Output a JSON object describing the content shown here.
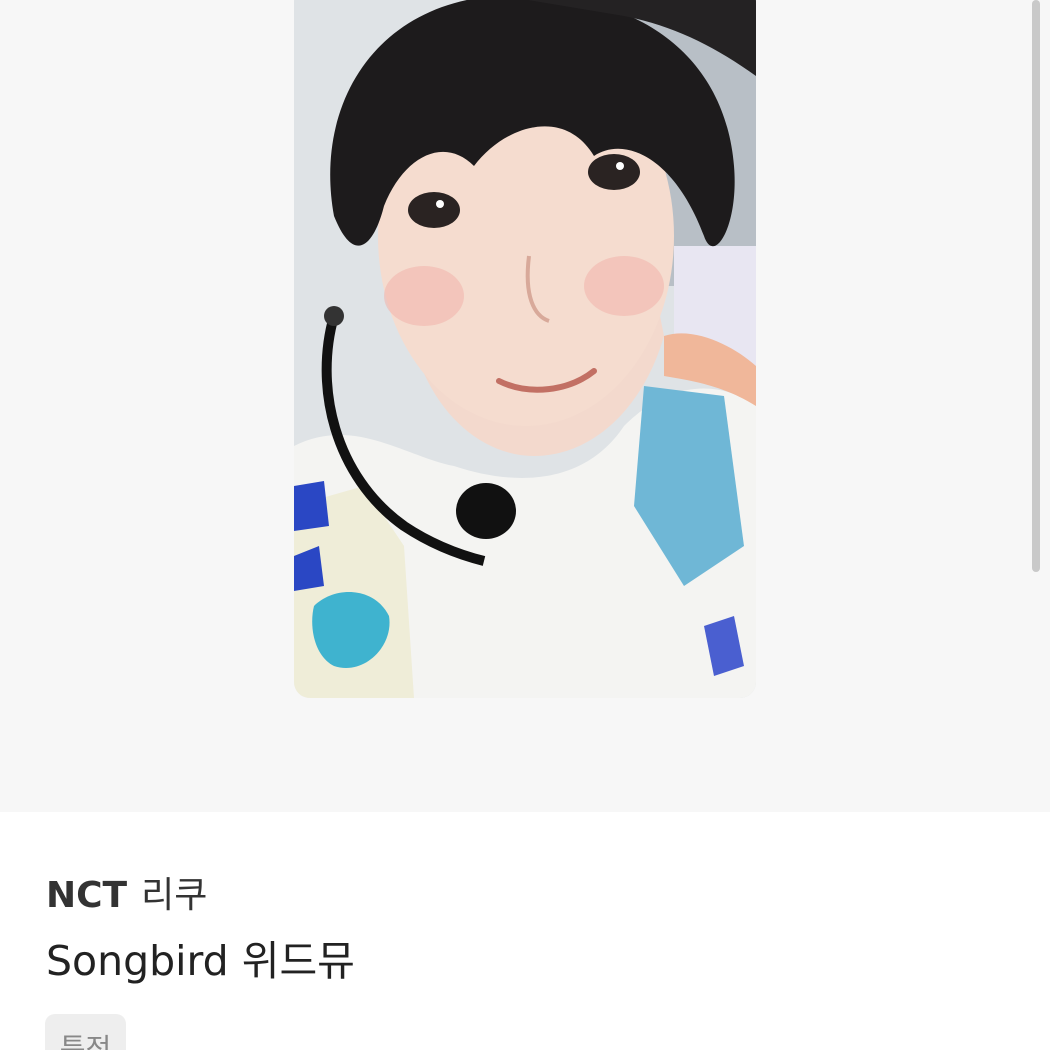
{
  "product": {
    "group": "NCT",
    "member": "리쿠",
    "album": "Songbird 위드뮤",
    "tag": "특전",
    "image_icon": "photocard-image"
  }
}
